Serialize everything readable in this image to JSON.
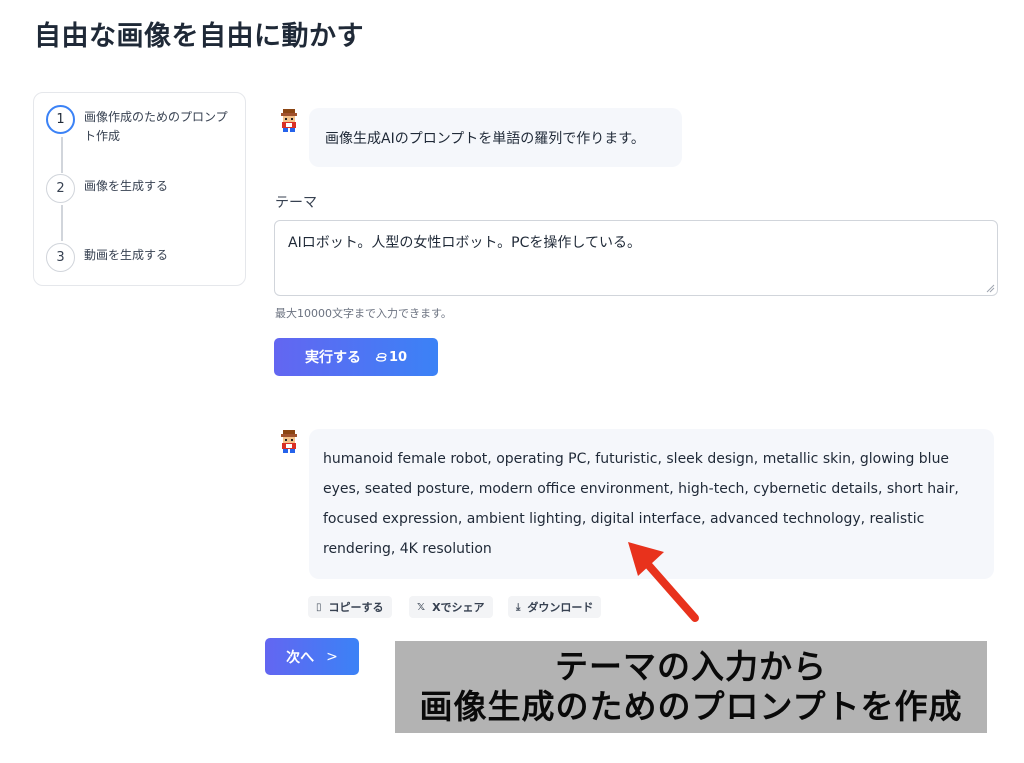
{
  "page": {
    "title": "自由な画像を自由に動かす"
  },
  "steps": [
    {
      "number": "1",
      "label": "画像作成のためのプロンプト作成",
      "active": true
    },
    {
      "number": "2",
      "label": "画像を生成する",
      "active": false
    },
    {
      "number": "3",
      "label": "動画を生成する",
      "active": false
    }
  ],
  "chat": {
    "intro_message": "画像生成AIのプロンプトを単語の羅列で作ります。",
    "result_message": "humanoid female robot, operating PC, futuristic, sleek design, metallic skin, glowing blue eyes, seated posture, modern office environment, high-tech, cybernetic details, short hair, focused expression, ambient lighting, digital interface, advanced technology, realistic rendering, 4K resolution"
  },
  "form": {
    "theme_label": "テーマ",
    "theme_value": "AIロボット。人型の女性ロボット。PCを操作している。",
    "helper_text": "最大10000文字まで入力できます。",
    "run_label": "実行する",
    "run_cost": "10"
  },
  "actions": [
    {
      "icon": "copy-icon",
      "glyph": "▯",
      "label": "コピーする"
    },
    {
      "icon": "x-logo-icon",
      "glyph": "𝕏",
      "label": "Xでシェア"
    },
    {
      "icon": "download-icon",
      "glyph": "⤓",
      "label": "ダウンロード"
    }
  ],
  "next": {
    "label": "次へ",
    "chevron": ">"
  },
  "caption": {
    "line1": "テーマの入力から",
    "line2": "画像生成のためのプロンプトを作成"
  },
  "colors": {
    "accent_start": "#6366f1",
    "accent_end": "#3b82f6",
    "arrow": "#e8321c",
    "bubble": "#f5f7fb"
  }
}
